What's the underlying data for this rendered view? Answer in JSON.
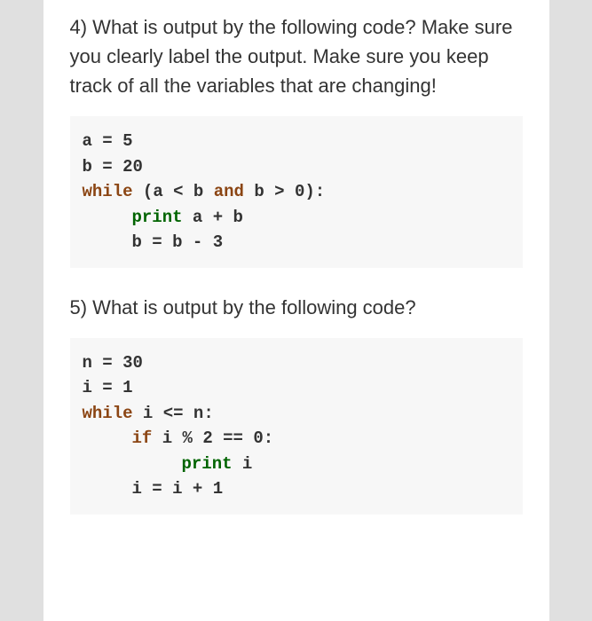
{
  "question4": {
    "text": "4) What is output by the following code?  Make sure you clearly label the output. Make sure you keep track of all the variables that are changing!",
    "code": {
      "line1": "a = 5",
      "line2": "b = 20",
      "line3_kw": "while",
      "line3_mid": " (a < b ",
      "line3_and": "and",
      "line3_end": " b > 0):",
      "line4_kw": "print",
      "line4_rest": " a + b",
      "line5": "b = b - 3"
    }
  },
  "question5": {
    "text": "5) What is output by the following code?",
    "code": {
      "line1": "n = 30",
      "line2": "i = 1",
      "line3_kw": "while",
      "line3_rest": " i <= n:",
      "line4_kw": "if",
      "line4_rest": " i % 2 == 0:",
      "line5_kw": "print",
      "line5_rest": " i",
      "line6": "i = i + 1"
    }
  }
}
